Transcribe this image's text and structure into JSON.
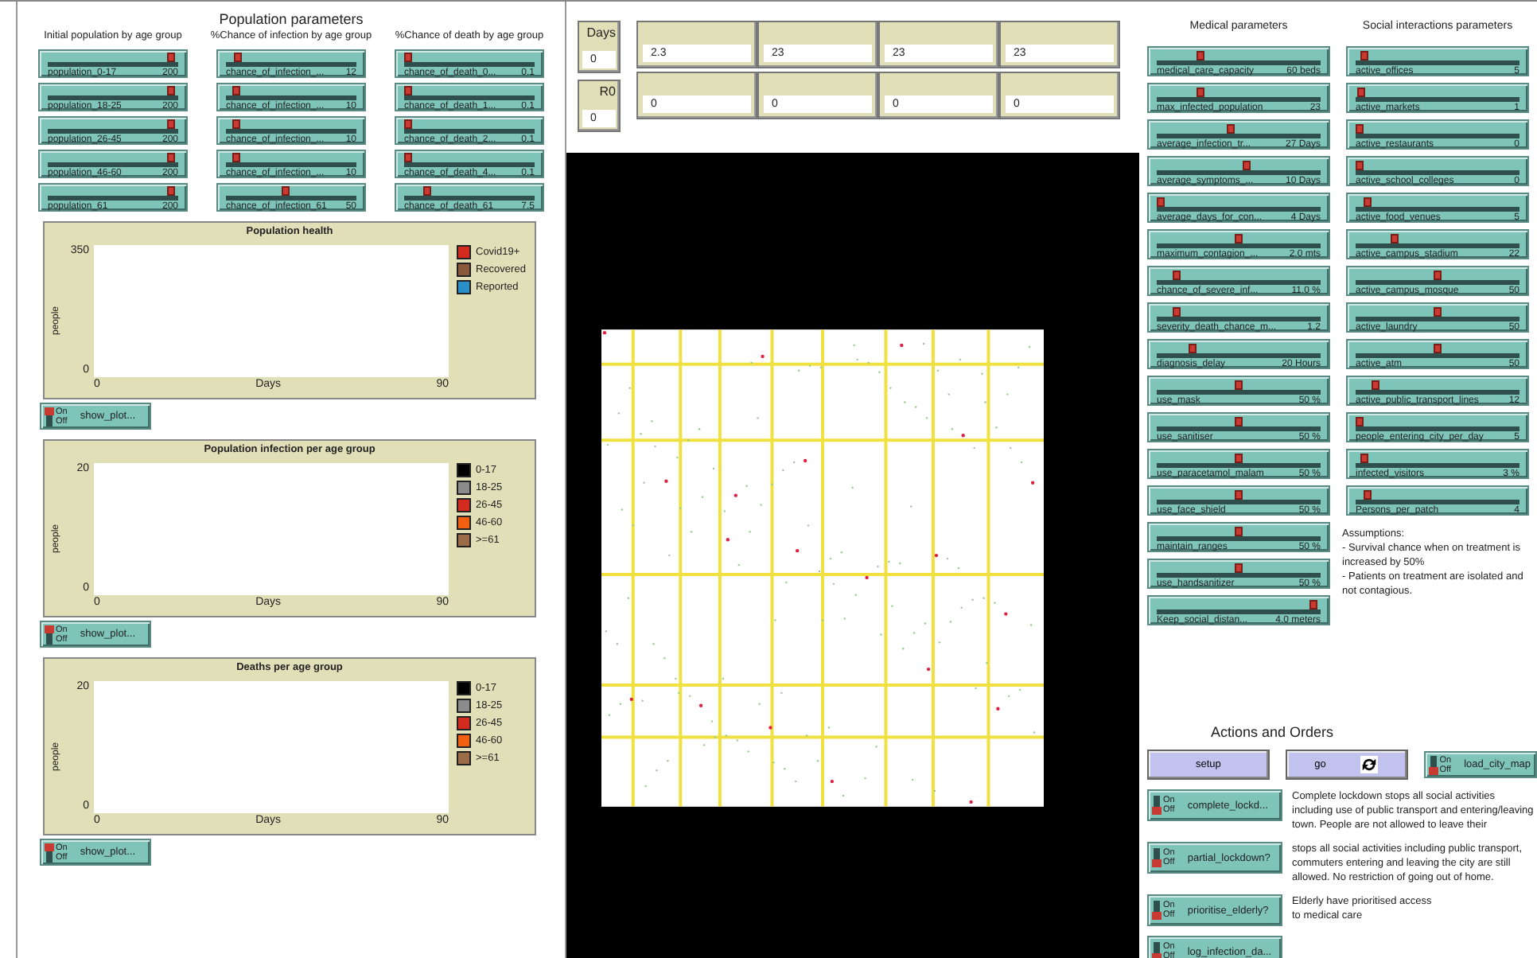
{
  "population_parameters": {
    "title": "Population parameters",
    "columns": [
      {
        "header": "Initial population by age group",
        "sliders": [
          {
            "name": "population_0-17",
            "value": "200",
            "level": 0.97
          },
          {
            "name": "population_18-25",
            "value": "200",
            "level": 0.97
          },
          {
            "name": "population_26-45",
            "value": "200",
            "level": 0.97
          },
          {
            "name": "population_46-60",
            "value": "200",
            "level": 0.97
          },
          {
            "name": "population_61",
            "value": "200",
            "level": 0.97
          }
        ]
      },
      {
        "header": "%Chance of infection by age group",
        "sliders": [
          {
            "name": "chance_of_infection_...",
            "value": "12",
            "level": 0.06
          },
          {
            "name": "chance_of_infection_...",
            "value": "10",
            "level": 0.05
          },
          {
            "name": "chance_of_infection_...",
            "value": "10",
            "level": 0.05
          },
          {
            "name": "chance_of_infection_...",
            "value": "10",
            "level": 0.05
          },
          {
            "name": "chance_of_infection_61",
            "value": "50",
            "level": 0.45
          }
        ]
      },
      {
        "header": "%Chance of death by age group",
        "sliders": [
          {
            "name": "chance_of_death_0...",
            "value": "0.1",
            "level": 0.0
          },
          {
            "name": "chance_of_death_1...",
            "value": "0.1",
            "level": 0.0
          },
          {
            "name": "chance_of_death_2...",
            "value": "0.1",
            "level": 0.0
          },
          {
            "name": "chance_of_death_4...",
            "value": "0.1",
            "level": 0.0
          },
          {
            "name": "chance_of_death_61",
            "value": "7.5",
            "level": 0.15
          }
        ]
      }
    ]
  },
  "plots": [
    {
      "title": "Population health",
      "ylabel": "people",
      "y_ticks": [
        "350",
        "0"
      ],
      "x_ticks": [
        "0",
        "90"
      ],
      "xlabel": "Days",
      "legend": [
        {
          "name": "Covid19+",
          "color": "#d42a20"
        },
        {
          "name": "Recovered",
          "color": "#8b5a3c"
        },
        {
          "name": "Reported",
          "color": "#2a8fc8"
        }
      ],
      "switch": {
        "label": "show_plot...",
        "on_label": "On",
        "off_label": "Off",
        "on": true
      }
    },
    {
      "title": "Population infection per age group",
      "ylabel": "people",
      "y_ticks": [
        "20",
        "0"
      ],
      "x_ticks": [
        "0",
        "90"
      ],
      "xlabel": "Days",
      "legend": [
        {
          "name": "0-17",
          "color": "#000000"
        },
        {
          "name": "18-25",
          "color": "#8c8c8c"
        },
        {
          "name": "26-45",
          "color": "#d42a20"
        },
        {
          "name": "46-60",
          "color": "#f06010"
        },
        {
          "name": ">=61",
          "color": "#9c6b48"
        }
      ],
      "switch": {
        "label": "show_plot...",
        "on_label": "On",
        "off_label": "Off",
        "on": true
      }
    },
    {
      "title": "Deaths per age group",
      "ylabel": "people",
      "y_ticks": [
        "20",
        "0"
      ],
      "x_ticks": [
        "0",
        "90"
      ],
      "xlabel": "Days",
      "legend": [
        {
          "name": "0-17",
          "color": "#000000"
        },
        {
          "name": "18-25",
          "color": "#8c8c8c"
        },
        {
          "name": "26-45",
          "color": "#d42a20"
        },
        {
          "name": "46-60",
          "color": "#f06010"
        },
        {
          "name": ">=61",
          "color": "#9c6b48"
        }
      ],
      "switch": {
        "label": "show_plot...",
        "on_label": "On",
        "off_label": "Off",
        "on": true
      }
    }
  ],
  "monitors": {
    "side": [
      {
        "label": "Days",
        "value": "0"
      },
      {
        "label": "R0",
        "value": "0"
      }
    ],
    "rows": [
      [
        {
          "value": "2.3"
        },
        {
          "value": "23"
        },
        {
          "value": "23"
        },
        {
          "value": "23"
        }
      ],
      [
        {
          "value": "0"
        },
        {
          "value": "0"
        },
        {
          "value": "0"
        },
        {
          "value": "0"
        }
      ]
    ]
  },
  "medical_parameters": {
    "title": "Medical parameters",
    "sliders": [
      {
        "name": "medical_care_capacity",
        "value": "60 beds",
        "level": 0.25
      },
      {
        "name": "max_infected_population",
        "value": "23",
        "level": 0.25
      },
      {
        "name": "average_infection_tr...",
        "value": "27 Days",
        "level": 0.45
      },
      {
        "name": "average_symptoms_...",
        "value": "10 Days",
        "level": 0.55
      },
      {
        "name": "average_days_for_con...",
        "value": "4 Days",
        "level": 0.0
      },
      {
        "name": "maximum_contagion_...",
        "value": "2.0 mts",
        "level": 0.5
      },
      {
        "name": "chance_of_severe_inf...",
        "value": "11.0 %",
        "level": 0.1
      },
      {
        "name": "severity_death_chance_m...",
        "value": "1.2",
        "level": 0.1
      },
      {
        "name": "diagnosis_delay",
        "value": "20 Hours",
        "level": 0.2
      },
      {
        "name": "use_mask",
        "value": "50 %",
        "level": 0.5
      },
      {
        "name": "use_sanitiser",
        "value": "50 %",
        "level": 0.5
      },
      {
        "name": "use_paracetamol_malam",
        "value": "50 %",
        "level": 0.5
      },
      {
        "name": "use_face_shield",
        "value": "50 %",
        "level": 0.5
      },
      {
        "name": "maintain_ranges",
        "value": "50 %",
        "level": 0.5
      },
      {
        "name": "use_handsanitizer",
        "value": "50 %",
        "level": 0.5
      },
      {
        "name": "Keep_social_distan...",
        "value": "4.0 meters",
        "level": 0.98
      }
    ]
  },
  "social_parameters": {
    "title": "Social interactions parameters",
    "sliders": [
      {
        "name": "active_offices",
        "value": "5",
        "level": 0.03
      },
      {
        "name": "active_markets",
        "value": "1",
        "level": 0.01
      },
      {
        "name": "active_restaurants",
        "value": "0",
        "level": 0.0
      },
      {
        "name": "active_school_colleges",
        "value": "0",
        "level": 0.0
      },
      {
        "name": "active_food_venues",
        "value": "5",
        "level": 0.05
      },
      {
        "name": "active_campus_stadium",
        "value": "22",
        "level": 0.22
      },
      {
        "name": "active_campus_mosque",
        "value": "50",
        "level": 0.5
      },
      {
        "name": "active_laundry",
        "value": "50",
        "level": 0.5
      },
      {
        "name": "active_atm",
        "value": "50",
        "level": 0.5
      },
      {
        "name": "active_public_transport_lines",
        "value": "12",
        "level": 0.1
      },
      {
        "name": "people_entering_city_per_day",
        "value": "5",
        "level": 0.0
      },
      {
        "name": "infected_visitors",
        "value": "3 %",
        "level": 0.03
      },
      {
        "name": "Persons_per_patch",
        "value": "4",
        "level": 0.05
      }
    ],
    "assumptions": [
      "Assumptions:",
      "- Survival chance when on treatment is increased by 50%",
      "- Patients on treatment are isolated and not contagious."
    ]
  },
  "actions": {
    "title": "Actions and Orders",
    "buttons": [
      {
        "label": "setup",
        "forever": false
      },
      {
        "label": "go",
        "forever": true
      }
    ],
    "load_switch": {
      "label": "load_city_map",
      "on_label": "On",
      "off_label": "Off",
      "on": false
    },
    "switches": [
      {
        "label": "complete_lockd...",
        "on_label": "On",
        "off_label": "Off",
        "on": false,
        "note": "Complete lockdown stops all social activities including use of public transport and entering/leaving town. People are not allowed to leave their"
      },
      {
        "label": "partial_lockdown?",
        "on_label": "On",
        "off_label": "Off",
        "on": false,
        "note": "stops all social activities including public transport, commuters entering and leaving the city are still allowed. No restriction of going out of home."
      },
      {
        "label": "prioritise_elderly?",
        "on_label": "On",
        "off_label": "Off",
        "on": false,
        "note": "Elderly have prioritised access to medical care"
      },
      {
        "label": "log_infection_da...",
        "on_label": "On",
        "off_label": "Off",
        "on": false
      }
    ]
  }
}
